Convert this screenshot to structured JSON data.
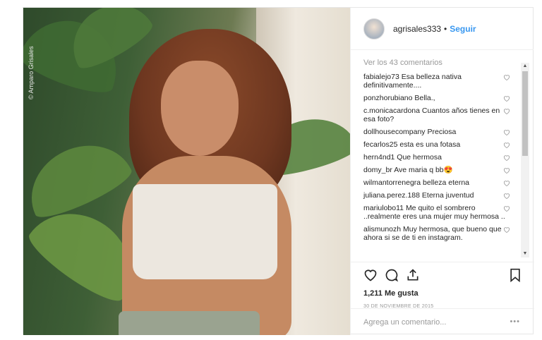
{
  "photo": {
    "watermark": "© Amparo Grisales"
  },
  "header": {
    "username": "agrisales333",
    "separator": "•",
    "follow_label": "Seguir"
  },
  "comments": {
    "view_all": "Ver los 43 comentarios",
    "items": [
      {
        "user": "fabialejo73",
        "text": "Esa belleza nativa definitivamente...."
      },
      {
        "user": "ponzhorubiano",
        "text": "Bella.,"
      },
      {
        "user": "c.monicacardona",
        "text": "Cuantos años tienes en esa foto?"
      },
      {
        "user": "dollhousecompany",
        "text": "Preciosa"
      },
      {
        "user": "fecarlos25",
        "text": "esta es una fotasa"
      },
      {
        "user": "hern4nd1",
        "text": "Que hermosa"
      },
      {
        "user": "domy_br",
        "text": "Ave maria q bb😍"
      },
      {
        "user": "wilmantorrenegra",
        "text": "belleza eterna"
      },
      {
        "user": "juliana.perez.188",
        "text": "Eterna juventud"
      },
      {
        "user": "mariulobo11",
        "text": "Me quito el sombrero ..realmente eres una mujer muy hermosa .."
      },
      {
        "user": "alismunozh",
        "text": "Muy hermosa, que bueno que ahora si se de ti en instagram."
      }
    ]
  },
  "actions": {
    "likes": "1,211 Me gusta",
    "date": "30 DE NOVIEMBRE DE 2015",
    "add_comment_placeholder": "Agrega un comentario...",
    "more": "•••"
  },
  "colors": {
    "link": "#3897f0",
    "muted": "#999999",
    "text": "#262626"
  }
}
